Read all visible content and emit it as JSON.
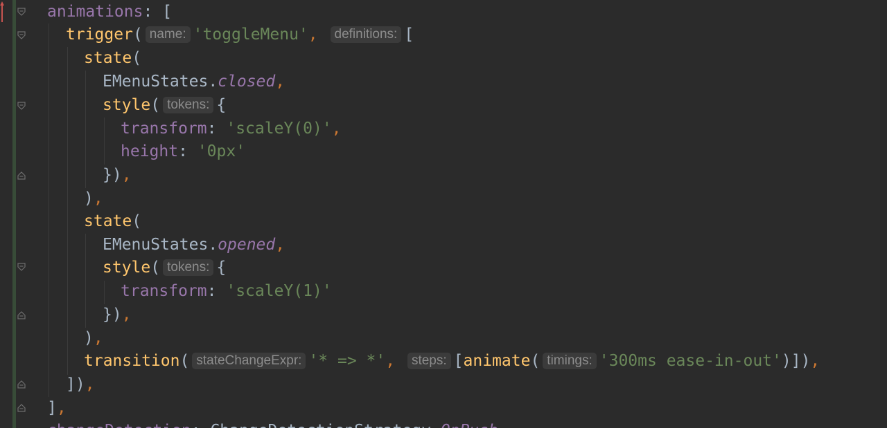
{
  "editor": {
    "colors": {
      "background": "#2b2b2b",
      "property": "#9876aa",
      "function": "#ffc66d",
      "string": "#6a8759",
      "punctuation": "#cc7832",
      "identifier": "#a9b7c6",
      "hint_bg": "#3b3b3b",
      "hint_fg": "#8c8c8c",
      "vcs_changed": "#384c38",
      "vcs_marker": "#c75450"
    },
    "code": {
      "l1": {
        "prop": "animations",
        "colon": ":",
        "bracket": " ["
      },
      "l2": {
        "fn": "trigger",
        "paren": "(",
        "hint_name": "name:",
        "str": "'toggleMenu'",
        "comma": ",",
        "hint_defs": "definitions:",
        "bracket": "["
      },
      "l3": {
        "fn": "state",
        "paren": "("
      },
      "l4": {
        "ident": "EMenuStates.",
        "member": "closed",
        "comma": ","
      },
      "l5": {
        "fn": "style",
        "paren": "(",
        "hint_tokens": "tokens:",
        "brace": "{"
      },
      "l6": {
        "prop": "transform",
        "colon": ":",
        "str": "'scaleY(0)'",
        "comma": ","
      },
      "l7": {
        "prop": "height",
        "colon": ":",
        "str": "'0px'"
      },
      "l8": {
        "close": "})",
        "comma": ","
      },
      "l9": {
        "close": ")",
        "comma": ","
      },
      "l10": {
        "fn": "state",
        "paren": "("
      },
      "l11": {
        "ident": "EMenuStates.",
        "member": "opened",
        "comma": ","
      },
      "l12": {
        "fn": "style",
        "paren": "(",
        "hint_tokens": "tokens:",
        "brace": "{"
      },
      "l13": {
        "prop": "transform",
        "colon": ":",
        "str": "'scaleY(1)'"
      },
      "l14": {
        "close": "})",
        "comma": ","
      },
      "l15": {
        "close": ")",
        "comma": ","
      },
      "l16": {
        "fn": "transition",
        "paren": "(",
        "hint_expr": "stateChangeExpr:",
        "str": "'* => *'",
        "comma": ",",
        "hint_steps": "steps:",
        "bracket": "[",
        "fn2": "animate",
        "paren2": "(",
        "hint_timings": "timings:",
        "str2": "'300ms ease-in-out'",
        "close": ")])",
        "comma2": ","
      },
      "l17": {
        "close": "])",
        "comma": ","
      },
      "l18": {
        "close": "]",
        "comma": ","
      },
      "l19": {
        "prop": "changeDetection",
        "colon": ":",
        "ident": " ChangeDetectionStrategy.",
        "member": "OnPush"
      }
    }
  }
}
